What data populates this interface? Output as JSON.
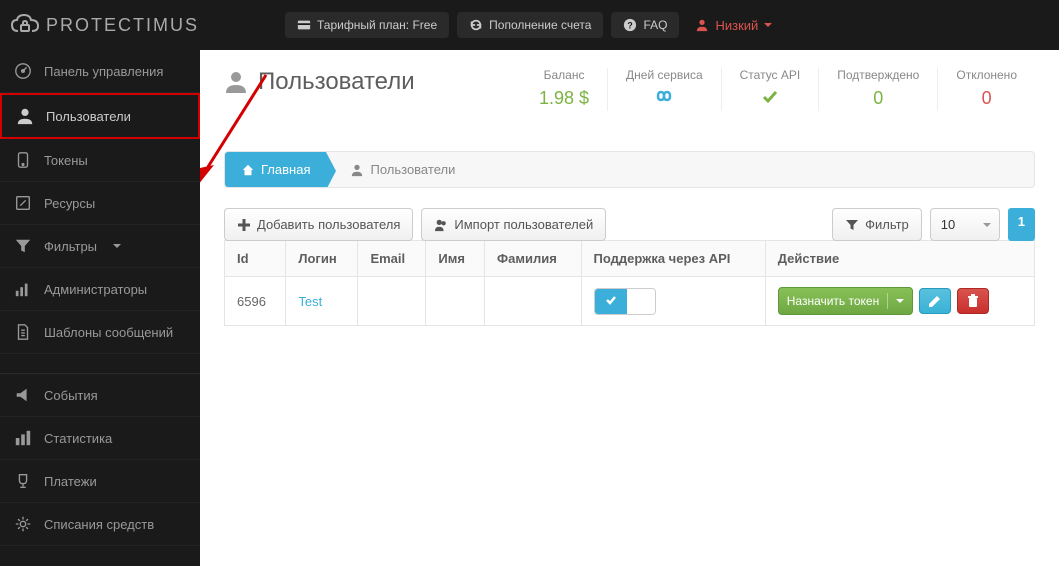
{
  "brand": "PROTECTIMUS",
  "topbar": {
    "tariff_label": "Тарифный план: Free",
    "recharge_label": "Пополнение счета",
    "faq_label": "FAQ",
    "user_label": "Низкий"
  },
  "sidebar": {
    "items": [
      {
        "label": "Панель управления",
        "name": "sidebar-item-dashboard"
      },
      {
        "label": "Пользователи",
        "name": "sidebar-item-users",
        "highlighted": true
      },
      {
        "label": "Токены",
        "name": "sidebar-item-tokens"
      },
      {
        "label": "Ресурсы",
        "name": "sidebar-item-resources"
      },
      {
        "label": "Фильтры",
        "name": "sidebar-item-filters",
        "caret": true
      },
      {
        "label": "Администраторы",
        "name": "sidebar-item-admins"
      },
      {
        "label": "Шаблоны сообщений",
        "name": "sidebar-item-templates"
      }
    ],
    "items2": [
      {
        "label": "События",
        "name": "sidebar-item-events"
      },
      {
        "label": "Статистика",
        "name": "sidebar-item-stats"
      },
      {
        "label": "Платежи",
        "name": "sidebar-item-payments"
      },
      {
        "label": "Списания средств",
        "name": "sidebar-item-debits"
      }
    ]
  },
  "page": {
    "title": "Пользователи"
  },
  "stats": {
    "balance_label": "Баланс",
    "balance_value": "1.98 $",
    "days_label": "Дней сервиса",
    "api_label": "Статус API",
    "confirmed_label": "Подтверждено",
    "confirmed_value": "0",
    "declined_label": "Отклонено",
    "declined_value": "0"
  },
  "breadcrumb": {
    "home": "Главная",
    "current": "Пользователи"
  },
  "toolbar": {
    "add_user": "Добавить пользователя",
    "import_users": "Импорт пользователей",
    "filter": "Фильтр",
    "page_size": "10",
    "page_number": "1"
  },
  "table": {
    "headers": {
      "id": "Id",
      "login": "Логин",
      "email": "Email",
      "first_name": "Имя",
      "last_name": "Фамилия",
      "api": "Поддержка через API",
      "action": "Действие"
    },
    "rows": [
      {
        "id": "6596",
        "login": "Test",
        "email": "",
        "first_name": "",
        "last_name": ""
      }
    ],
    "assign_token": "Назначить токен"
  }
}
